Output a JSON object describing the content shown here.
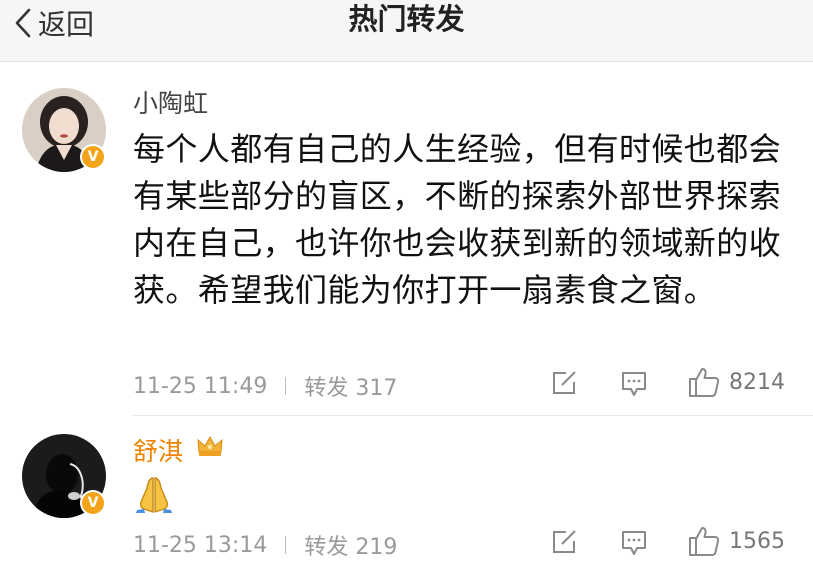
{
  "nav": {
    "back_label": "返回",
    "title": "热门转发"
  },
  "posts": [
    {
      "username": "小陶虹",
      "content": "每个人都有自己的人生经验，但有时候也都会有某些部分的盲区，不断的探索外部世界探索内在自己，也许你也会收获到新的领域新的收获。希望我们能为你打开一扇素食之窗。",
      "time": "11-25 11:49",
      "repost_text": "转发 317",
      "likes": "8214",
      "verified_badge": "V"
    },
    {
      "username": "舒淇",
      "content_emoji": "folded-hands-emoji",
      "time": "11-25 13:14",
      "repost_text": "转发 219",
      "likes": "1565",
      "verified_badge": "V"
    }
  ],
  "colors": {
    "nav_bg": "#f6f6f6",
    "username_highlight": "#f08400",
    "badge": "#f3a41a",
    "meta_text": "#9a9a9a"
  },
  "icons": [
    "back-chevron-icon",
    "edit-icon",
    "comment-icon",
    "thumbs-up-icon",
    "crown-icon",
    "verified-icon"
  ]
}
